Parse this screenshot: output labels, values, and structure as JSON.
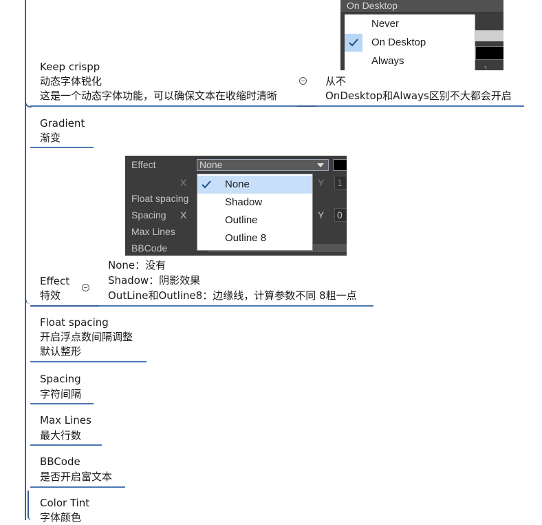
{
  "nodes": {
    "keep_crisp": {
      "title": "Keep crispp",
      "desc1": "动态字体锐化",
      "desc2": "这是一个动态字体功能，可以确保文本在收缩时清晰",
      "note1": "从不",
      "note2": "OnDesktop和Always区别不大都会开启"
    },
    "gradient": {
      "title": "Gradient",
      "desc1": "渐变"
    },
    "effect": {
      "title": "Effect",
      "desc1": "特效",
      "note1": "None：没有",
      "note2": "Shadow：阴影效果",
      "note3": "OutLine和Outline8：边缘线，计算参数不同 8粗一点"
    },
    "float_spacing": {
      "title": "Float spacing",
      "desc1": "开启浮点数间隔调整",
      "desc2": "默认整形"
    },
    "spacing": {
      "title": "Spacing",
      "desc1": "字符间隔"
    },
    "max_lines": {
      "title": "Max Lines",
      "desc1": "最大行数"
    },
    "bbcode": {
      "title": "BBCode",
      "desc1": "是否开启富文本"
    },
    "color_tint": {
      "title": "Color Tint",
      "desc1": "字体颜色"
    }
  },
  "screenshot_keep_crisp": {
    "field_value": "On Desktop",
    "options": [
      "Never",
      "On Desktop",
      "Always"
    ],
    "selected": "On Desktop",
    "stray_digit": "1"
  },
  "screenshot_effect": {
    "labels": {
      "effect": "Effect",
      "x1": "X",
      "float_spacing": "Float spacing",
      "spacing": "Spacing",
      "x2": "X",
      "max_lines": "Max Lines",
      "bbcode": "BBCode",
      "y1": "Y",
      "y2": "Y",
      "val1": "1",
      "val2": "0"
    },
    "field_value": "None",
    "options": [
      "None",
      "Shadow",
      "Outline",
      "Outline 8"
    ],
    "selected": "None"
  },
  "colors": {
    "branch": "#3a5f94",
    "underline": "#4a78b0",
    "menu_highlight": "#b8d6f6"
  }
}
